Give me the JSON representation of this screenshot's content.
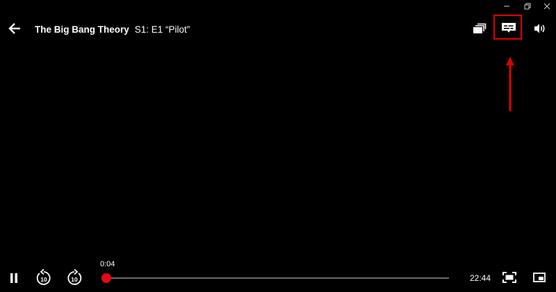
{
  "window": {
    "controls": {
      "minimize": "minimize-icon",
      "restore": "restore-icon",
      "close": "close-icon"
    }
  },
  "header": {
    "back": "back-arrow-icon",
    "show_title": "The Big Bang Theory",
    "episode": "S1: E1 “Pilot”",
    "right_icons": [
      "episodes-icon",
      "subtitles-icon",
      "volume-icon"
    ]
  },
  "player": {
    "elapsed": "0:04",
    "remaining": "22:44",
    "progress_fraction": 0.003,
    "controls": [
      "pause-icon",
      "rewind-10-icon",
      "forward-10-icon",
      "fullscreen-icon",
      "picture-in-picture-icon"
    ],
    "skip_seconds": "10"
  },
  "annotation": {
    "highlight_color": "#e00000",
    "target": "subtitles-button"
  },
  "colors": {
    "accent": "#e50914",
    "background": "#000000"
  }
}
